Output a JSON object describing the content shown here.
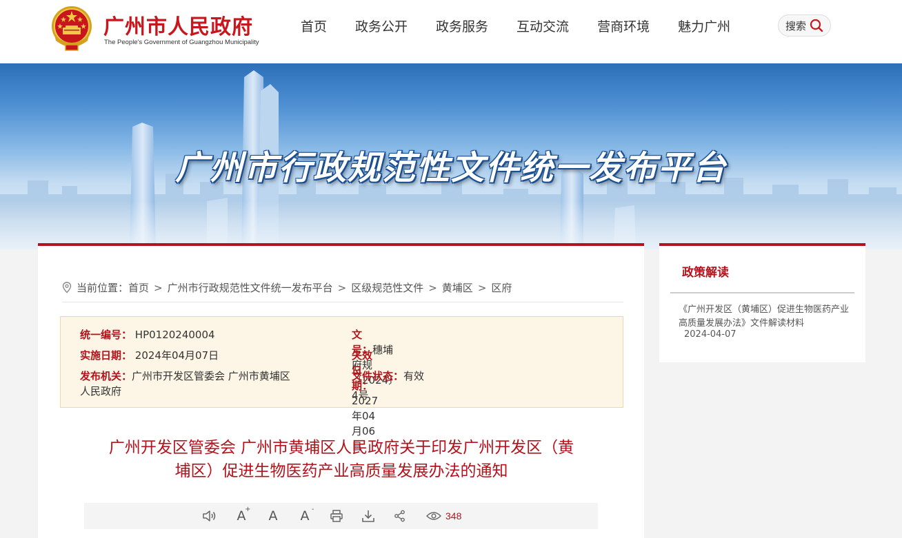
{
  "header": {
    "site_title": "广州市人民政府",
    "site_subtitle": "The People's Government of Guangzhou Municipality",
    "nav": [
      "首页",
      "政务公开",
      "政务服务",
      "互动交流",
      "营商环境",
      "魅力广州"
    ],
    "search_label": "搜索"
  },
  "banner": {
    "title": "广州市行政规范性文件统一发布平台"
  },
  "breadcrumb": {
    "prefix": "当前位置：",
    "items": [
      "首页",
      "广州市行政规范性文件统一发布平台",
      "区级规范性文件",
      "黄埔区",
      "区府"
    ],
    "separator": ">"
  },
  "meta": {
    "serial_label": "统一编号：",
    "serial_value": "HP0120240004",
    "docno_label": "文　　号：",
    "docno_value": "穗埔府规〔2024〕4号",
    "effective_label": "实施日期：",
    "effective_value": "2024年04月07日",
    "expiry_label": "失效日期：",
    "expiry_value": "2027年04月06日",
    "issuer_label": "发布机关：",
    "issuer_value_line1": "广州市开发区管委会 广州市黄埔区",
    "issuer_value_line2": "人民政府",
    "status_label": "文件状态：",
    "status_value": "有效"
  },
  "document": {
    "title_line1": "广州开发区管委会 广州市黄埔区人民政府关于印发广州开发区（黄",
    "title_line2": "埔区）促进生物医药产业高质量发展办法的通知"
  },
  "toolbar": {
    "icons": [
      "speaker-icon",
      "font-increase-icon",
      "font-reset-icon",
      "font-decrease-icon",
      "print-icon",
      "download-icon",
      "share-icon"
    ],
    "view_count": "348",
    "font_glyph": "A",
    "plus_glyph": "+",
    "minus_glyph": "-"
  },
  "sidebar": {
    "title": "政策解读",
    "items": [
      {
        "text": "《广州开发区（黄埔区）促进生物医药产业高质量发展办法》文件解读材料",
        "date": "2024-04-07"
      }
    ]
  },
  "colors": {
    "brand_red": "#b5121b",
    "meta_bg": "#fdf6e6",
    "banner_blue": "#2d6fb8"
  }
}
